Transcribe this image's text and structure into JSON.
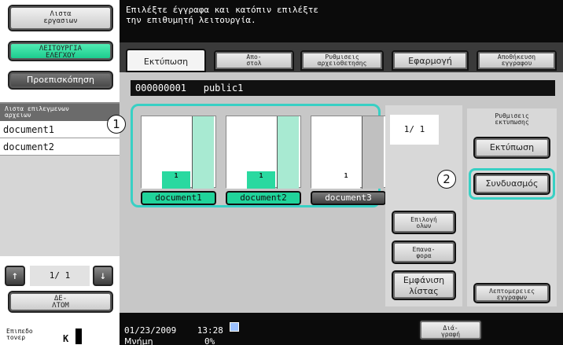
{
  "sidebar": {
    "job_list_label": "Λιστα\nεργασιων",
    "utility_label": "ΛΕΙΤΟΥΡΓΙΑ\nΕΛΕΓΧΟΥ",
    "preview_label": "Προεπισκόπηση",
    "selected_list_header": "Λιστα επιλεγμενων\nαρχειων",
    "files": [
      "document1",
      "document2"
    ],
    "page_indicator": "1/  1",
    "delete_label": "ΔΕ-\nΛΤΟΜ",
    "toner_label": "Επιπεδο\nτονερ",
    "toner_color": "K"
  },
  "message": "Επιλέξτε έγγραφα και κατόπιν επιλέξτε\nτην επιθυμητή λειτουργία.",
  "tabs": [
    {
      "label": "Εκτύπωση",
      "active": true
    },
    {
      "label": "Απο-\nστολ",
      "active": false
    },
    {
      "label": "Ρυθμισεις\nαρχειοθετησης",
      "active": false
    },
    {
      "label": "Εφαρμογή",
      "active": false
    },
    {
      "label": "Αποθήκευση\nεγγραφου",
      "active": false
    }
  ],
  "box": {
    "number": "000000001",
    "name": "public1"
  },
  "documents": [
    {
      "name": "document1",
      "count": "1",
      "selected": true
    },
    {
      "name": "document2",
      "count": "1",
      "selected": true
    },
    {
      "name": "document3",
      "count": "1",
      "selected": false
    }
  ],
  "doc_page_indicator": "1/  1",
  "callouts": [
    "1",
    "2"
  ],
  "actions": {
    "select_all": "Επιλογή\nολων",
    "reset": "Επανα-\nφορα",
    "show_list": "Εμφάνιση\nλίστας"
  },
  "print_settings": {
    "group_label": "Ρυθμισεις\nεκτυπωσης",
    "print_button": "Εκτύπωση",
    "combine_button": "Συνδυασμός",
    "details_button": "Λεπτομερειες\nεγγραφων"
  },
  "status": {
    "datetime": "01/23/2009    13:28",
    "memory_label": "Μνήμη",
    "memory_value": "0%",
    "close_button": "Διά-\nγραφή"
  },
  "colors": {
    "accent_teal": "#38d0c4",
    "selected_green": "#20d39a",
    "active_green": "#17c98a"
  }
}
